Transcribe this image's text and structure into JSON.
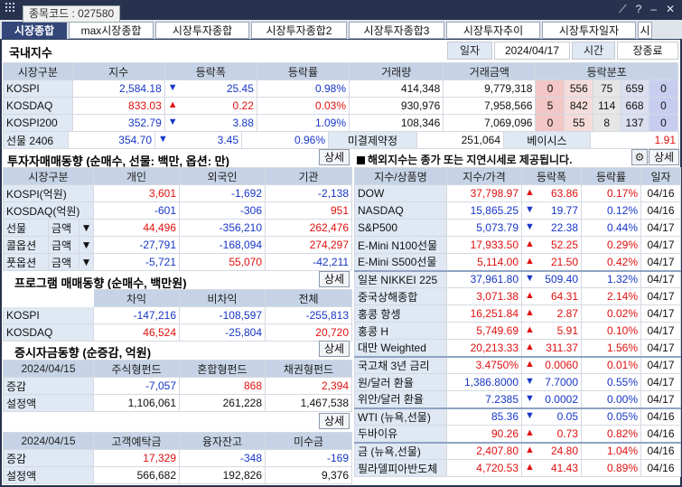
{
  "window": {
    "code_tip": "종목코드 : 027580"
  },
  "tabs": [
    "시장종합",
    "max시장종합",
    "시장투자종합",
    "시장투자종합2",
    "시장투자종합3",
    "시장투자추이",
    "시장투자일자",
    "시"
  ],
  "header": {
    "title": "국내지수",
    "date_label": "일자",
    "date": "2024/04/17",
    "time_label": "시간",
    "time": "장종료"
  },
  "index_table": {
    "headers": [
      "시장구분",
      "지수",
      "등락폭",
      "등락률",
      "거래량",
      "거래금액",
      "등락분포"
    ],
    "rows": [
      {
        "name": "KOSPI",
        "value": "2,584.18",
        "dir": "down",
        "change": "25.45",
        "rate": "0.98%",
        "volume": "414,348",
        "amount": "9,779,318",
        "dist": [
          "0",
          "556",
          "75",
          "659",
          "0"
        ]
      },
      {
        "name": "KOSDAQ",
        "value": "833.03",
        "dir": "up",
        "change": "0.22",
        "rate": "0.03%",
        "volume": "930,976",
        "amount": "7,958,566",
        "dist": [
          "5",
          "842",
          "114",
          "668",
          "0"
        ]
      },
      {
        "name": "KOSPI200",
        "value": "352.79",
        "dir": "down",
        "change": "3.88",
        "rate": "1.09%",
        "volume": "108,346",
        "amount": "7,069,096",
        "dist": [
          "0",
          "55",
          "8",
          "137",
          "0"
        ]
      }
    ]
  },
  "futures": {
    "name": "선물 2406",
    "value": "354.70",
    "dir": "down",
    "change": "3.45",
    "rate": "0.96%",
    "oi_label": "미결제약정",
    "oi": "251,064",
    "basis_label": "베이시스",
    "basis": "1.91"
  },
  "investor": {
    "title": "투자자매매동향 (순매수, 선물: 백만, 옵션: 만)",
    "detail": "상세",
    "headers": [
      "시장구분",
      "개인",
      "외국인",
      "기관"
    ],
    "rows": [
      {
        "name": "KOSPI(억원)",
        "sub": "",
        "v": [
          "3,601",
          "-1,692",
          "-2,138"
        ],
        "c": [
          "red",
          "blue",
          "blue"
        ]
      },
      {
        "name": "KOSDAQ(억원)",
        "sub": "",
        "v": [
          "-601",
          "-306",
          "951"
        ],
        "c": [
          "blue",
          "blue",
          "red"
        ]
      },
      {
        "name": "선물",
        "sub": "금액",
        "v": [
          "44,496",
          "-356,210",
          "262,476"
        ],
        "c": [
          "red",
          "blue",
          "red"
        ]
      },
      {
        "name": "콜옵션",
        "sub": "금액",
        "v": [
          "-27,791",
          "-168,094",
          "274,297"
        ],
        "c": [
          "blue",
          "blue",
          "red"
        ]
      },
      {
        "name": "풋옵션",
        "sub": "금액",
        "v": [
          "-5,721",
          "55,070",
          "-42,211"
        ],
        "c": [
          "blue",
          "red",
          "blue"
        ]
      }
    ]
  },
  "program": {
    "title": "프로그램 매매동향 (순매수, 백만원)",
    "detail": "상세",
    "headers": [
      "차익",
      "비차익",
      "전체"
    ],
    "rows": [
      {
        "name": "KOSPI",
        "v": [
          "-147,216",
          "-108,597",
          "-255,813"
        ],
        "c": [
          "blue",
          "blue",
          "blue"
        ]
      },
      {
        "name": "KOSDAQ",
        "v": [
          "46,524",
          "-25,804",
          "20,720"
        ],
        "c": [
          "red",
          "blue",
          "red"
        ]
      }
    ]
  },
  "fund": {
    "title": "증시자금동향 (순증감, 억원)",
    "detail": "상세",
    "headers": [
      "2024/04/15",
      "주식형펀드",
      "혼합형펀드",
      "채권형펀드"
    ],
    "rows": [
      {
        "name": "증감",
        "v": [
          "-7,057",
          "868",
          "2,394"
        ],
        "c": [
          "blue",
          "red",
          "red"
        ]
      },
      {
        "name": "설정액",
        "v": [
          "1,106,061",
          "261,228",
          "1,467,538"
        ],
        "c": [
          "",
          "",
          ""
        ]
      }
    ]
  },
  "deposit": {
    "detail": "상세",
    "headers": [
      "2024/04/15",
      "고객예탁금",
      "융자잔고",
      "미수금"
    ],
    "rows": [
      {
        "name": "증감",
        "v": [
          "17,329",
          "-348",
          "-169"
        ],
        "c": [
          "red",
          "blue",
          "blue"
        ]
      },
      {
        "name": "설정액",
        "v": [
          "566,682",
          "192,826",
          "9,376"
        ],
        "c": [
          "",
          "",
          ""
        ]
      }
    ]
  },
  "overseas": {
    "notice": "해외지수는 종가 또는 지연시세로 제공됩니다.",
    "detail": "상세",
    "headers": [
      "지수/상품명",
      "지수/가격",
      "등락폭",
      "등락률",
      "일자"
    ],
    "rows": [
      {
        "name": "DOW",
        "price": "37,798.97",
        "dir": "up",
        "change": "63.86",
        "rate": "0.17%",
        "date": "04/16",
        "grp": 1
      },
      {
        "name": "NASDAQ",
        "price": "15,865.25",
        "dir": "down",
        "change": "19.77",
        "rate": "0.12%",
        "date": "04/16",
        "grp": 1
      },
      {
        "name": "S&P500",
        "price": "5,073.79",
        "dir": "down",
        "change": "22.38",
        "rate": "0.44%",
        "date": "04/17",
        "grp": 1
      },
      {
        "name": "E-Mini N100선물",
        "price": "17,933.50",
        "dir": "up",
        "change": "52.25",
        "rate": "0.29%",
        "date": "04/17",
        "grp": 1
      },
      {
        "name": "E-Mini S500선물",
        "price": "5,114.00",
        "dir": "up",
        "change": "21.50",
        "rate": "0.42%",
        "date": "04/17",
        "grp": 1
      },
      {
        "name": "일본 NIKKEI 225",
        "price": "37,961.80",
        "dir": "down",
        "change": "509.40",
        "rate": "1.32%",
        "date": "04/17",
        "grp": 2
      },
      {
        "name": "중국상해종합",
        "price": "3,071.38",
        "dir": "up",
        "change": "64.31",
        "rate": "2.14%",
        "date": "04/17",
        "grp": 2
      },
      {
        "name": "홍콩 항셍",
        "price": "16,251.84",
        "dir": "up",
        "change": "2.87",
        "rate": "0.02%",
        "date": "04/17",
        "grp": 2
      },
      {
        "name": "홍콩 H",
        "price": "5,749.69",
        "dir": "up",
        "change": "5.91",
        "rate": "0.10%",
        "date": "04/17",
        "grp": 2
      },
      {
        "name": "대만 Weighted",
        "price": "20,213.33",
        "dir": "up",
        "change": "311.37",
        "rate": "1.56%",
        "date": "04/17",
        "grp": 2
      },
      {
        "name": "국고채 3년 금리",
        "price": "3.4750%",
        "dir": "up",
        "change": "0.0060",
        "rate": "0.01%",
        "date": "04/17",
        "grp": 3
      },
      {
        "name": "원/달러 환율",
        "price": "1,386.8000",
        "dir": "down",
        "change": "7.7000",
        "rate": "0.55%",
        "date": "04/17",
        "grp": 3
      },
      {
        "name": "위안/달러 환율",
        "price": "7.2385",
        "dir": "down",
        "change": "0.0002",
        "rate": "0.00%",
        "date": "04/17",
        "grp": 3
      },
      {
        "name": "WTI (뉴욕,선물)",
        "price": "85.36",
        "dir": "down",
        "change": "0.05",
        "rate": "0.05%",
        "date": "04/16",
        "grp": 4
      },
      {
        "name": "두바이유",
        "price": "90.26",
        "dir": "up",
        "change": "0.73",
        "rate": "0.82%",
        "date": "04/16",
        "grp": 4
      },
      {
        "name": "금 (뉴욕,선물)",
        "price": "2,407.80",
        "dir": "up",
        "change": "24.80",
        "rate": "1.04%",
        "date": "04/16",
        "grp": 5
      },
      {
        "name": "필라델피아반도체",
        "price": "4,720.53",
        "dir": "up",
        "change": "41.43",
        "rate": "0.89%",
        "date": "04/16",
        "grp": 5
      }
    ]
  },
  "colors": {
    "up": "#e01010",
    "down": "#1736c7",
    "header_bg": "#c6d3e6",
    "tab_active": "#34477a"
  }
}
